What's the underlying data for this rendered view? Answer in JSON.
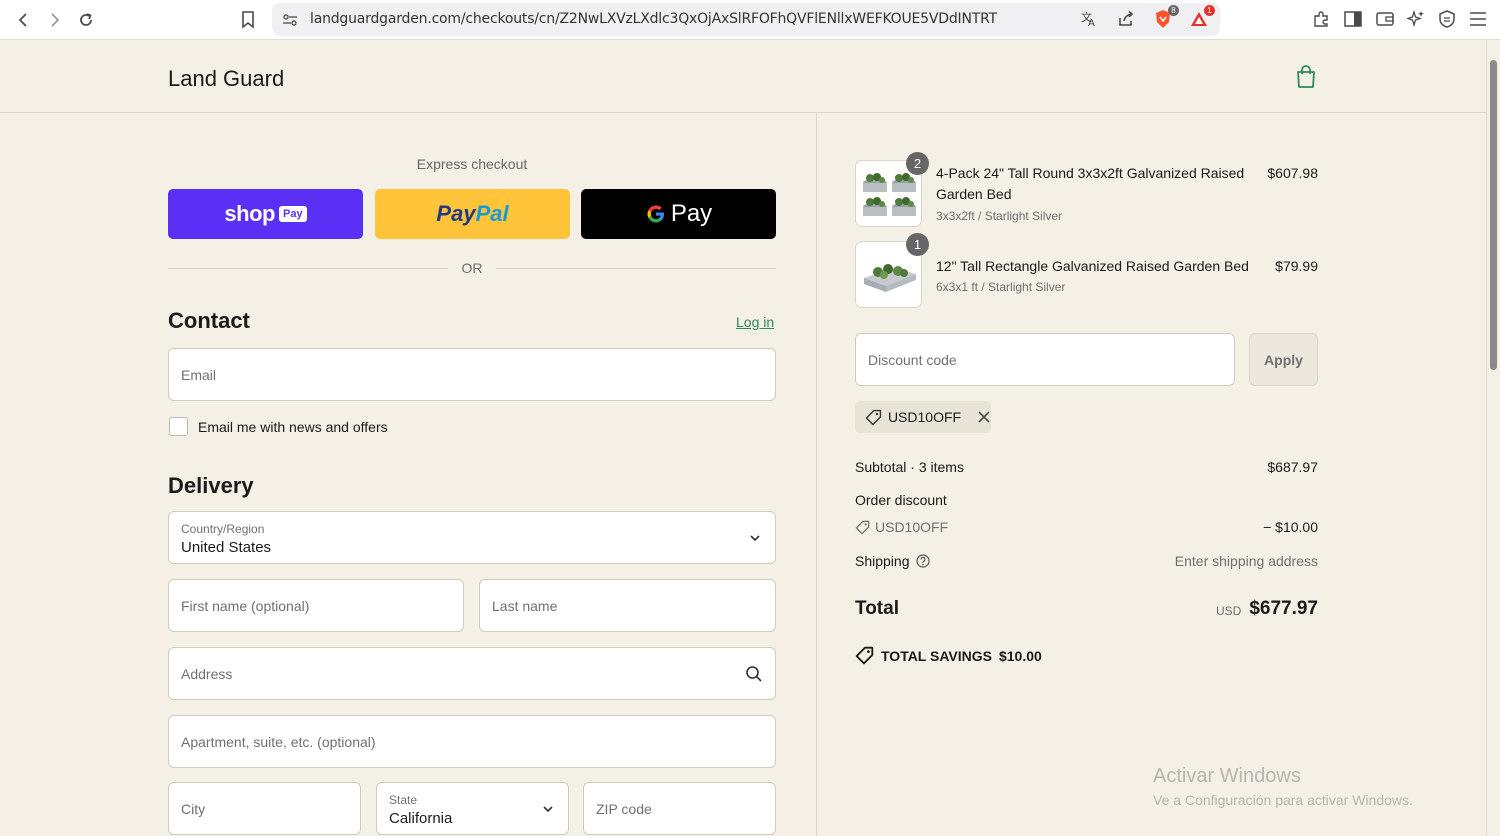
{
  "browser": {
    "url": "landguardgarden.com/checkouts/cn/Z2NwLXVzLXdlc3QxOjAxSlRFOFhQVFlENllxWEFKOUE5VDdINTRT",
    "brave_badge": "8",
    "alert_badge": "1"
  },
  "header": {
    "brand": "Land Guard"
  },
  "express": {
    "title": "Express checkout",
    "shop_word": "shop",
    "shop_pay": "Pay",
    "paypal_a": "Pay",
    "paypal_b": "Pal",
    "gpay_word": "Pay",
    "or": "OR"
  },
  "contact": {
    "heading": "Contact",
    "login": "Log in",
    "email_placeholder": "Email",
    "newsletter_label": "Email me with news and offers"
  },
  "delivery": {
    "heading": "Delivery",
    "country_label": "Country/Region",
    "country_value": "United States",
    "first_name_placeholder": "First name (optional)",
    "last_name_placeholder": "Last name",
    "address_placeholder": "Address",
    "apartment_placeholder": "Apartment, suite, etc. (optional)",
    "city_placeholder": "City",
    "state_label": "State",
    "state_value": "California",
    "zip_placeholder": "ZIP code"
  },
  "cart": {
    "items": [
      {
        "qty": "2",
        "name": "4-Pack 24\" Tall Round 3x3x2ft Galvanized Raised Garden Bed",
        "variant": "3x3x2ft / Starlight Silver",
        "price": "$607.98"
      },
      {
        "qty": "1",
        "name": "12\" Tall Rectangle Galvanized Raised Garden Bed",
        "variant": "6x3x1 ft / Starlight Silver",
        "price": "$79.99"
      }
    ],
    "discount_placeholder": "Discount code",
    "apply": "Apply",
    "applied_code": "USD10OFF"
  },
  "summary": {
    "subtotal_label": "Subtotal · 3 items",
    "subtotal_value": "$687.97",
    "order_discount_label": "Order discount",
    "discount_code": "USD10OFF",
    "discount_value": "− $10.00",
    "shipping_label": "Shipping",
    "shipping_value": "Enter shipping address",
    "total_label": "Total",
    "currency": "USD",
    "total_value": "$677.97",
    "savings_label": "TOTAL SAVINGS",
    "savings_value": "$10.00"
  },
  "watermark": {
    "line1": "Activar Windows",
    "line2": "Ve a Configuración para activar Windows."
  },
  "colors": {
    "accent": "#2f8a5a",
    "background": "#f4f0e6",
    "shop_pay": "#5a31f4",
    "paypal": "#ffc439"
  }
}
